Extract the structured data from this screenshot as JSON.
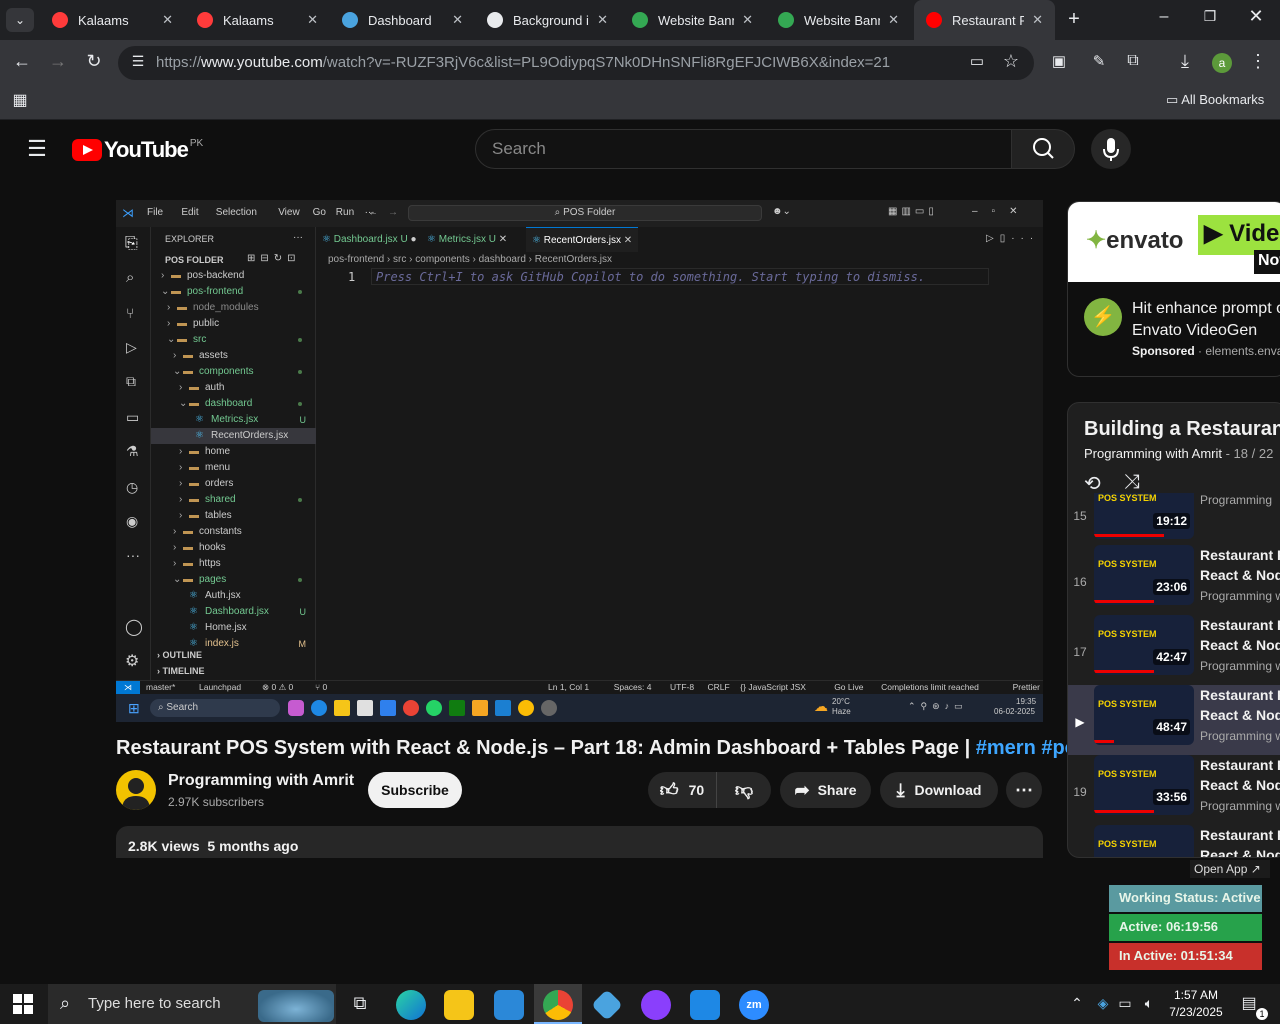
{
  "browser": {
    "tabs": [
      {
        "label": "Kalaams",
        "active": false
      },
      {
        "label": "Kalaams",
        "active": false
      },
      {
        "label": "Dashboard",
        "active": false
      },
      {
        "label": "Background i",
        "active": false
      },
      {
        "label": "Website Bann",
        "active": false
      },
      {
        "label": "Website Bann",
        "active": false
      },
      {
        "label": "Restaurant PC",
        "active": true
      }
    ],
    "url_prefix": "https://",
    "url_host": "www.youtube.com",
    "url_rest": "/watch?v=-RUZF3RjV6c&list=PL9OdiypqS7Nk0DHnSNFli8RgEFJCIWB6X&index=21",
    "bookmarks_label": "All Bookmarks",
    "profile_initial": "a"
  },
  "youtube": {
    "logo_text": "YouTube",
    "country": "PK",
    "search_placeholder": "Search"
  },
  "vscode": {
    "menu": [
      "File",
      "Edit",
      "Selection",
      "View",
      "Go",
      "Run",
      "···"
    ],
    "command_center": "POS Folder",
    "explorer_title": "EXPLORER",
    "folder_title": "POS FOLDER",
    "tabs": [
      {
        "label": "Dashboard.jsx",
        "badge": "U"
      },
      {
        "label": "Metrics.jsx",
        "badge": "U"
      },
      {
        "label": "RecentOrders.jsx",
        "badge": ""
      }
    ],
    "breadcrumb": "pos-frontend  ›  src  ›  components  ›  dashboard  ›  RecentOrders.jsx",
    "line_number": "1",
    "copilot_hint": "Press Ctrl+I to ask GitHub Copilot to do something. Start typing to dismiss.",
    "tree": [
      {
        "label": "pos-backend",
        "indent": 1,
        "color": "#cccccc",
        "mark": ""
      },
      {
        "label": "pos-frontend",
        "indent": 1,
        "color": "#73c991",
        "mark": "dot"
      },
      {
        "label": "node_modules",
        "indent": 2,
        "color": "#8b8b8b",
        "mark": ""
      },
      {
        "label": "public",
        "indent": 2,
        "color": "#cccccc",
        "mark": ""
      },
      {
        "label": "src",
        "indent": 2,
        "color": "#73c991",
        "mark": "dot"
      },
      {
        "label": "assets",
        "indent": 3,
        "color": "#cccccc",
        "mark": ""
      },
      {
        "label": "components",
        "indent": 3,
        "color": "#73c991",
        "mark": "dot"
      },
      {
        "label": "auth",
        "indent": 4,
        "color": "#cccccc",
        "mark": ""
      },
      {
        "label": "dashboard",
        "indent": 4,
        "color": "#73c991",
        "mark": "dot"
      },
      {
        "label": "Metrics.jsx",
        "indent": 5,
        "color": "#73c991",
        "mark": "U"
      },
      {
        "label": "RecentOrders.jsx",
        "indent": 5,
        "color": "#cccccc",
        "mark": ""
      },
      {
        "label": "home",
        "indent": 4,
        "color": "#cccccc",
        "mark": ""
      },
      {
        "label": "menu",
        "indent": 4,
        "color": "#cccccc",
        "mark": ""
      },
      {
        "label": "orders",
        "indent": 4,
        "color": "#cccccc",
        "mark": ""
      },
      {
        "label": "shared",
        "indent": 4,
        "color": "#73c991",
        "mark": "dot"
      },
      {
        "label": "tables",
        "indent": 4,
        "color": "#cccccc",
        "mark": ""
      },
      {
        "label": "constants",
        "indent": 3,
        "color": "#cccccc",
        "mark": ""
      },
      {
        "label": "hooks",
        "indent": 3,
        "color": "#cccccc",
        "mark": ""
      },
      {
        "label": "https",
        "indent": 3,
        "color": "#cccccc",
        "mark": ""
      },
      {
        "label": "pages",
        "indent": 3,
        "color": "#73c991",
        "mark": "dot"
      },
      {
        "label": "Auth.jsx",
        "indent": 4,
        "color": "#cccccc",
        "mark": ""
      },
      {
        "label": "Dashboard.jsx",
        "indent": 4,
        "color": "#73c991",
        "mark": "U"
      },
      {
        "label": "Home.jsx",
        "indent": 4,
        "color": "#cccccc",
        "mark": ""
      },
      {
        "label": "index.js",
        "indent": 4,
        "color": "#e2c08d",
        "mark": "M"
      }
    ],
    "outline": "OUTLINE",
    "timeline": "TIMELINE",
    "status_left": [
      "master*",
      "Launchpad",
      "⊗ 0 ⚠ 0",
      "⑂ 0"
    ],
    "status_right": [
      "Ln 1, Col 1",
      "Spaces: 4",
      "UTF-8",
      "CRLF",
      "{} JavaScript JSX",
      "Go Live",
      "Completions limit reached",
      "Prettier"
    ],
    "win_search": "Search",
    "weather_temp": "20°C",
    "weather_desc": "Haze",
    "win_time": "19:35",
    "win_date": "06-02-2025"
  },
  "video": {
    "title": "Restaurant POS System with React & Node.js – Part 18: Admin Dashboard + Tables Page | ",
    "hashtags": "#mern #pos",
    "channel": "Programming with Amrit",
    "subscribers": "2.97K subscribers",
    "subscribe_label": "Subscribe",
    "likes": "70",
    "share_label": "Share",
    "download_label": "Download",
    "views": "2.8K views",
    "age": "5 months ago"
  },
  "ad": {
    "brand": "envato",
    "banner_right": "Vide",
    "banner_now": "Now",
    "headline_1": "Hit enhance prompt o",
    "headline_2": "Envato VideoGen",
    "sponsored": "Sponsored",
    "domain": "· elements.enva"
  },
  "playlist": {
    "title": "Building a Restaurant P",
    "channel": "Programming with Amrit",
    "position": "18 / 22",
    "items": [
      {
        "n": "15",
        "dur": "19:12",
        "line1": "React & Nod",
        "line2": "",
        "channel": "Programming",
        "progress": 0.7,
        "current": false
      },
      {
        "n": "16",
        "dur": "23:06",
        "line1": "Restaurant P",
        "line2": "React & Node",
        "channel": "Programming w",
        "progress": 0.6,
        "current": false
      },
      {
        "n": "17",
        "dur": "42:47",
        "line1": "Restaurant P",
        "line2": "React & Node",
        "channel": "Programming w",
        "progress": 0.6,
        "current": false
      },
      {
        "n": "▶",
        "dur": "48:47",
        "line1": "Restaurant P",
        "line2": "React & Node",
        "channel": "Programming w",
        "progress": 0.2,
        "current": true
      },
      {
        "n": "19",
        "dur": "33:56",
        "line1": "Restaurant P",
        "line2": "React & Node",
        "channel": "Programming w",
        "progress": 0.6,
        "current": false
      },
      {
        "n": "20",
        "dur": "",
        "line1": "Restaurant P",
        "line2": "React & Node",
        "channel": "",
        "progress": 0,
        "current": false
      }
    ]
  },
  "overlay": {
    "open_app": "Open App ↗",
    "working_status": "Working Status: Active",
    "active": "Active: 06:19:56",
    "inactive": "In Active: 01:51:34"
  },
  "taskbar": {
    "search_placeholder": "Type here to search",
    "time": "1:57 AM",
    "date": "7/23/2025",
    "notif_count": "1"
  }
}
